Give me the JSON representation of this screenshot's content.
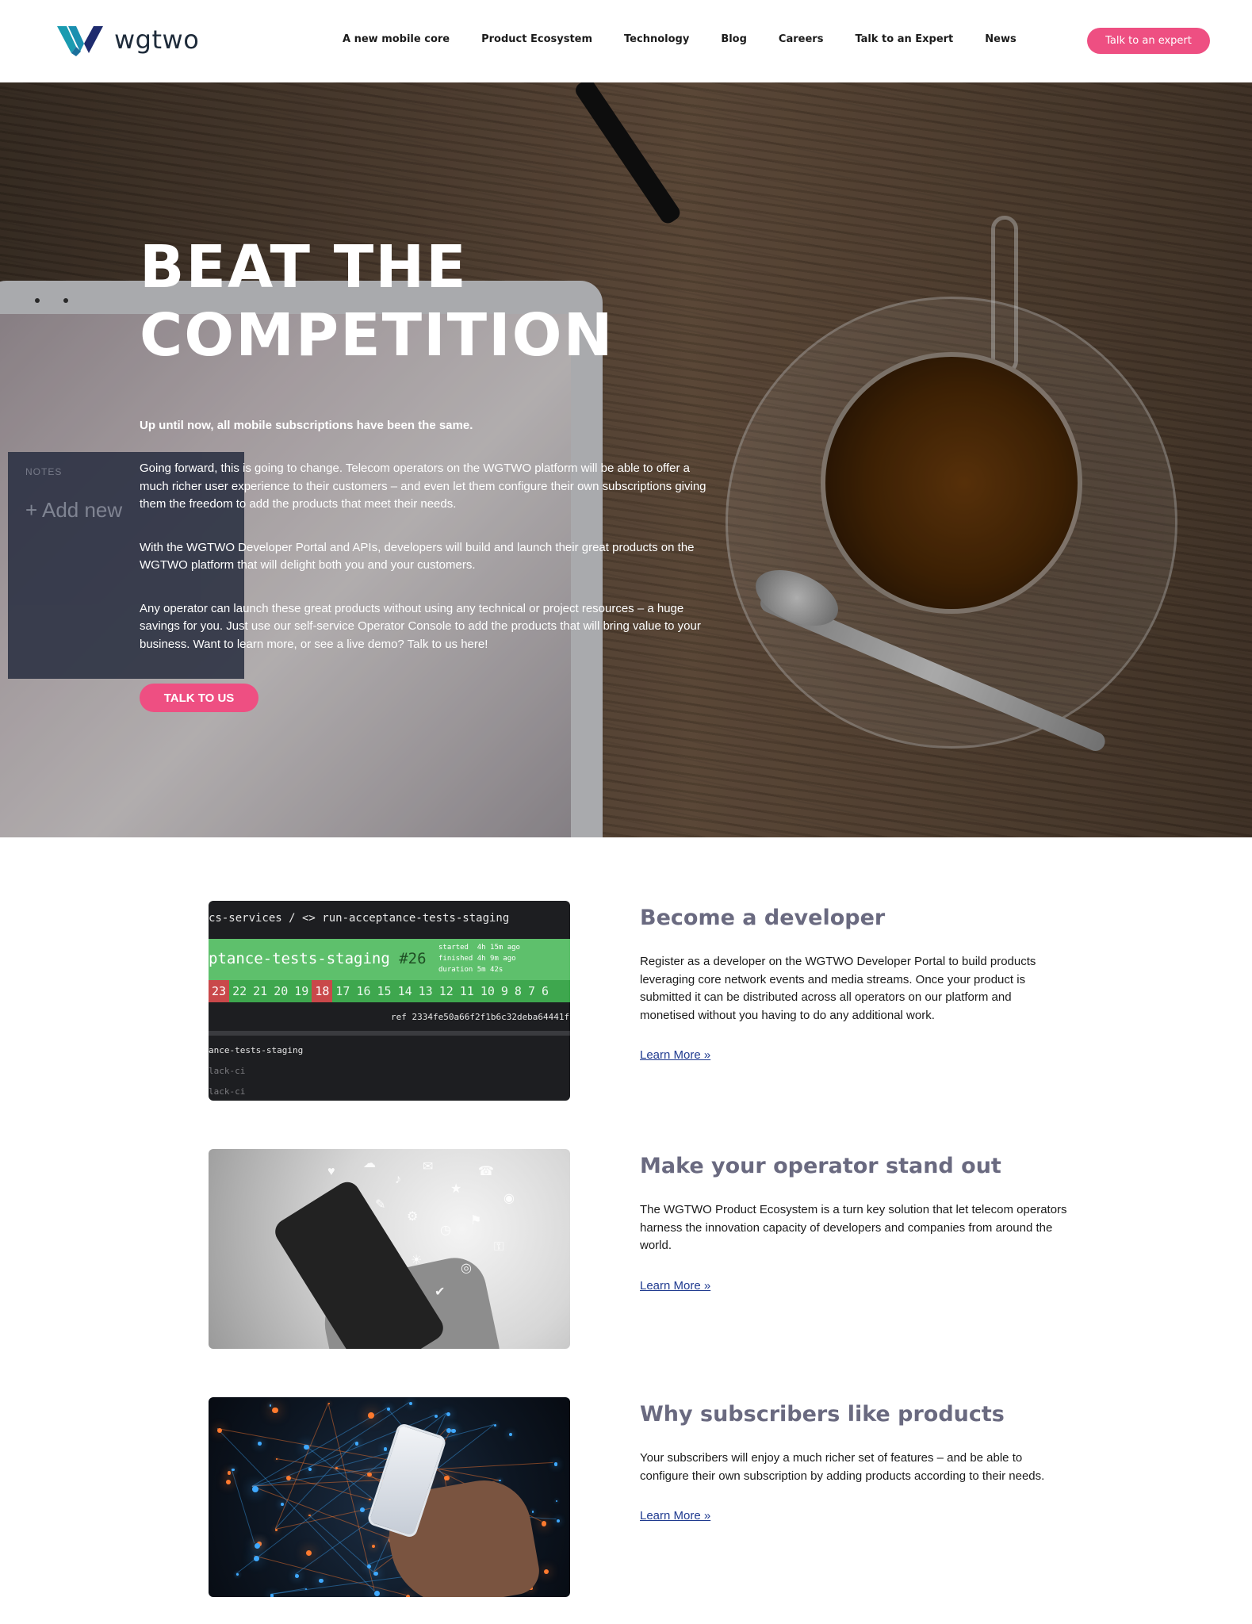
{
  "header": {
    "logo_text": "wgtwo",
    "nav": [
      "A new mobile core",
      "Product Ecosystem",
      "Technology",
      "Blog",
      "Careers",
      "Talk to an Expert",
      "News"
    ],
    "cta_label": "Talk to an expert"
  },
  "hero": {
    "title_line1": "BEAT THE",
    "title_line2": "COMPETITION",
    "lead": "Up until now, all mobile subscriptions have been the same.",
    "paragraphs": [
      "Going forward, this is going to change. Telecom operators on the WGTWO platform will be able to offer a much richer user experience to their customers – and even let them configure their own subscriptions giving them the freedom to add the products that meet their needs.",
      "With the WGTWO Developer Portal and APIs, developers will build and launch their great products on the WGTWO platform that will delight both you and your customers.",
      "Any operator can launch these great products without using any technical or project resources – a huge savings for you. Just use our self-service Operator Console to add the products that will bring value to your business. Want to learn more, or see a live demo? Talk to us here!"
    ],
    "button_label": "TALK TO US",
    "photo_text": {
      "notes_label": "NOTES",
      "notes_add": "+ Add new"
    }
  },
  "features": [
    {
      "title": "Become a developer",
      "body": "Register as a developer on the WGTWO Developer Portal to build products leveraging core network events and media streams. Once your product is submitted it can be distributed across all operators on our platform and monetised without you having to do any additional work.",
      "link": "Learn More »",
      "screenshot_text": {
        "path": "cs-services  /  <> run-acceptance-tests-staging",
        "job_title": "ptance-tests-staging",
        "job_number": "#26",
        "meta": "started  4h 15m ago\nfinished 4h 9m ago\nduration 5m 42s",
        "builds": [
          "23",
          "22",
          "21",
          "20",
          "19",
          "18",
          "17",
          "16",
          "15",
          "14",
          "13",
          "12",
          "11",
          "10",
          "9",
          "8",
          "7",
          "6"
        ],
        "ref": "ref  2334fe50a66f2f1b6c32deba64441f",
        "lines": [
          "ance-tests-staging",
          "lack-ci",
          "lack-ci"
        ]
      }
    },
    {
      "title": "Make your operator stand out",
      "body": "The WGTWO Product Ecosystem is a turn key solution that let telecom operators harness the innovation capacity of developers and companies from around the world.",
      "link": "Learn More »"
    },
    {
      "title": "Why subscribers like products",
      "body": "Your subscribers will enjoy a much richer set of features – and be able to configure their own subscription by adding products according to their needs.",
      "link": "Learn More »"
    }
  ],
  "colors": {
    "accent": "#ee4f82",
    "heading": "#6a6a80",
    "link": "#1f3a8f",
    "logo_teal": "#1a9bb0",
    "logo_navy": "#1e2b6e"
  }
}
